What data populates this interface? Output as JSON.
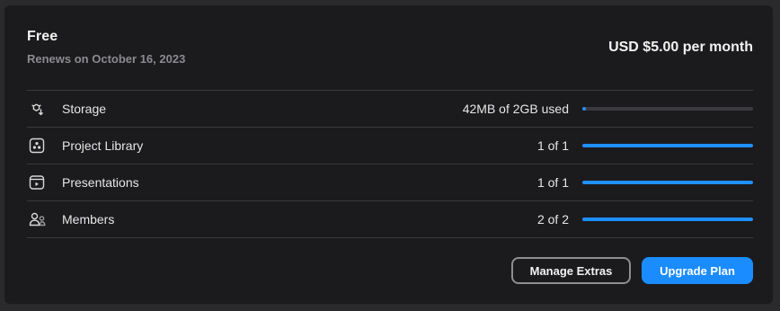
{
  "plan": {
    "name": "Free",
    "renews": "Renews on October 16, 2023",
    "price": "USD $5.00 per month"
  },
  "usage": [
    {
      "label": "Storage",
      "value": "42MB of 2GB used",
      "fraction": 0.02,
      "icon": "cloud-sync-icon"
    },
    {
      "label": "Project Library",
      "value": "1 of 1",
      "fraction": 1.0,
      "icon": "project-library-icon"
    },
    {
      "label": "Presentations",
      "value": "1 of 1",
      "fraction": 1.0,
      "icon": "presentation-icon"
    },
    {
      "label": "Members",
      "value": "2 of 2",
      "fraction": 1.0,
      "icon": "members-icon"
    }
  ],
  "actions": {
    "manage_label": "Manage Extras",
    "upgrade_label": "Upgrade Plan"
  },
  "colors": {
    "accent": "#1a8cff",
    "bar_fill": "#1e90ff",
    "card_bg": "#1b1b1d"
  }
}
